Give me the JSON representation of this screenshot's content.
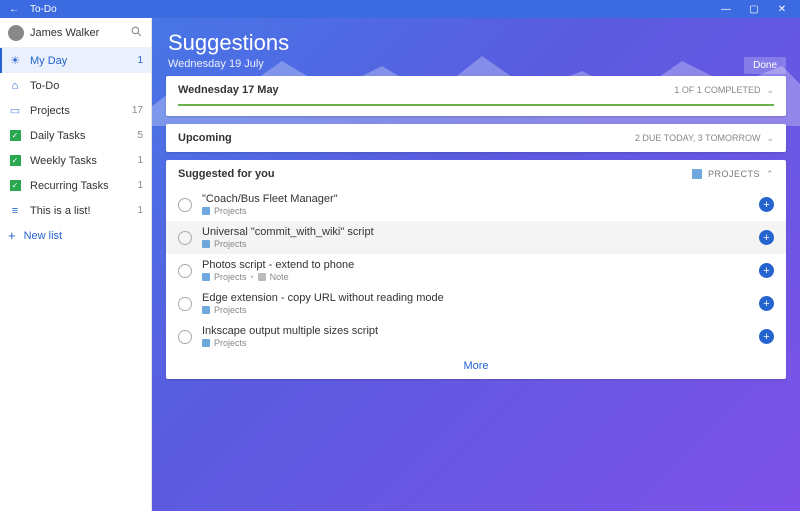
{
  "titlebar": {
    "app_name": "To-Do"
  },
  "sidebar": {
    "user_name": "James Walker",
    "items": [
      {
        "icon": "sun",
        "label": "My Day",
        "count": "1",
        "active": true
      },
      {
        "icon": "house",
        "label": "To-Do",
        "count": ""
      },
      {
        "icon": "folder",
        "label": "Projects",
        "count": "17"
      },
      {
        "icon": "check",
        "label": "Daily Tasks",
        "count": "5"
      },
      {
        "icon": "check",
        "label": "Weekly Tasks",
        "count": "1"
      },
      {
        "icon": "check",
        "label": "Recurring Tasks",
        "count": "1"
      },
      {
        "icon": "list",
        "label": "This is a list!",
        "count": "1"
      }
    ],
    "new_list": "New list"
  },
  "header": {
    "title": "Suggestions",
    "date": "Wednesday 19 July",
    "done": "Done"
  },
  "completed_card": {
    "title": "Wednesday 17 May",
    "status": "1 OF 1 COMPLETED"
  },
  "upcoming_card": {
    "title": "Upcoming",
    "status": "2 DUE TODAY, 3 TOMORROW"
  },
  "suggest_card": {
    "title": "Suggested for you",
    "badge": "PROJECTS",
    "tasks": [
      {
        "title": "\"Coach/Bus Fleet Manager\"",
        "list": "Projects",
        "note": false,
        "hov": false
      },
      {
        "title": "Universal \"commit_with_wiki\" script",
        "list": "Projects",
        "note": false,
        "hov": true
      },
      {
        "title": "Photos script - extend to phone",
        "list": "Projects",
        "note": true,
        "hov": false
      },
      {
        "title": "Edge extension - copy URL without reading mode",
        "list": "Projects",
        "note": false,
        "hov": false
      },
      {
        "title": "Inkscape output multiple sizes script",
        "list": "Projects",
        "note": false,
        "hov": false
      }
    ],
    "note_label": "Note",
    "more": "More"
  }
}
